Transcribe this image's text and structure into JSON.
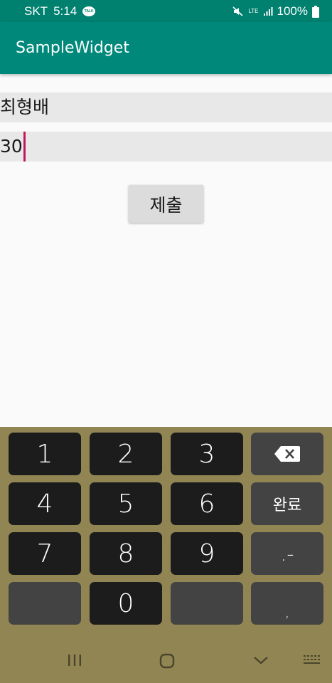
{
  "status_bar": {
    "carrier": "SKT",
    "time": "5:14",
    "talk_badge": "TALK",
    "network": "LTE",
    "battery": "100%"
  },
  "app_bar": {
    "title": "SampleWidget"
  },
  "form": {
    "name_value": "최형배",
    "age_value": "30",
    "submit_label": "제출"
  },
  "keyboard": {
    "keys": [
      "1",
      "2",
      "3",
      "4",
      "5",
      "6",
      "7",
      "8",
      "9",
      "0"
    ],
    "done_label": "완료",
    "dot_minus_label": ".-",
    "comma_label": ","
  },
  "colors": {
    "accent": "#00897b",
    "cursor": "#c2185b",
    "keyboard_bg": "#918653"
  },
  "icons": [
    "talk-icon",
    "mute-icon",
    "lte-icon",
    "signal-icon",
    "battery-icon",
    "backspace-icon",
    "recents-icon",
    "home-icon",
    "back-icon",
    "keyboard-icon"
  ]
}
